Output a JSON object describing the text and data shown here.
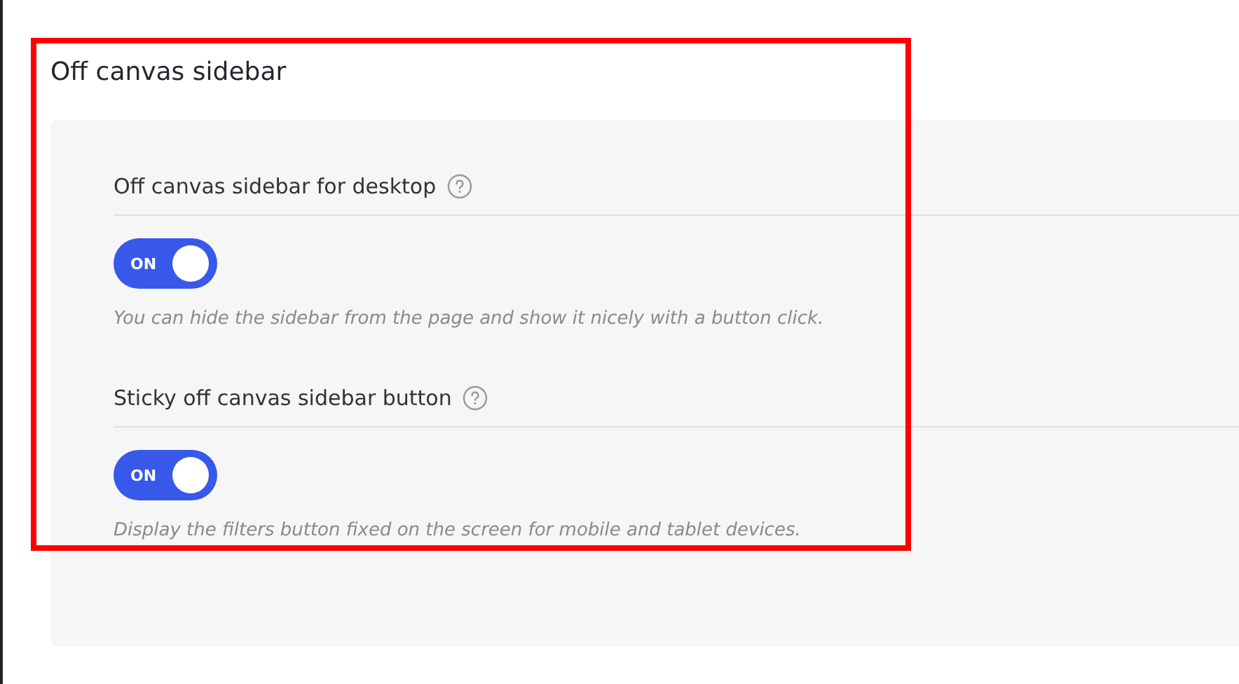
{
  "section": {
    "title": "Off canvas sidebar"
  },
  "settings": [
    {
      "label": "Off canvas sidebar for desktop",
      "toggle": {
        "on": true,
        "text": "ON"
      },
      "description": "You can hide the sidebar from the page and show it nicely with a button click."
    },
    {
      "label": "Sticky off canvas sidebar button",
      "toggle": {
        "on": true,
        "text": "ON"
      },
      "description": "Display the filters button fixed on the screen for mobile and tablet devices."
    }
  ]
}
